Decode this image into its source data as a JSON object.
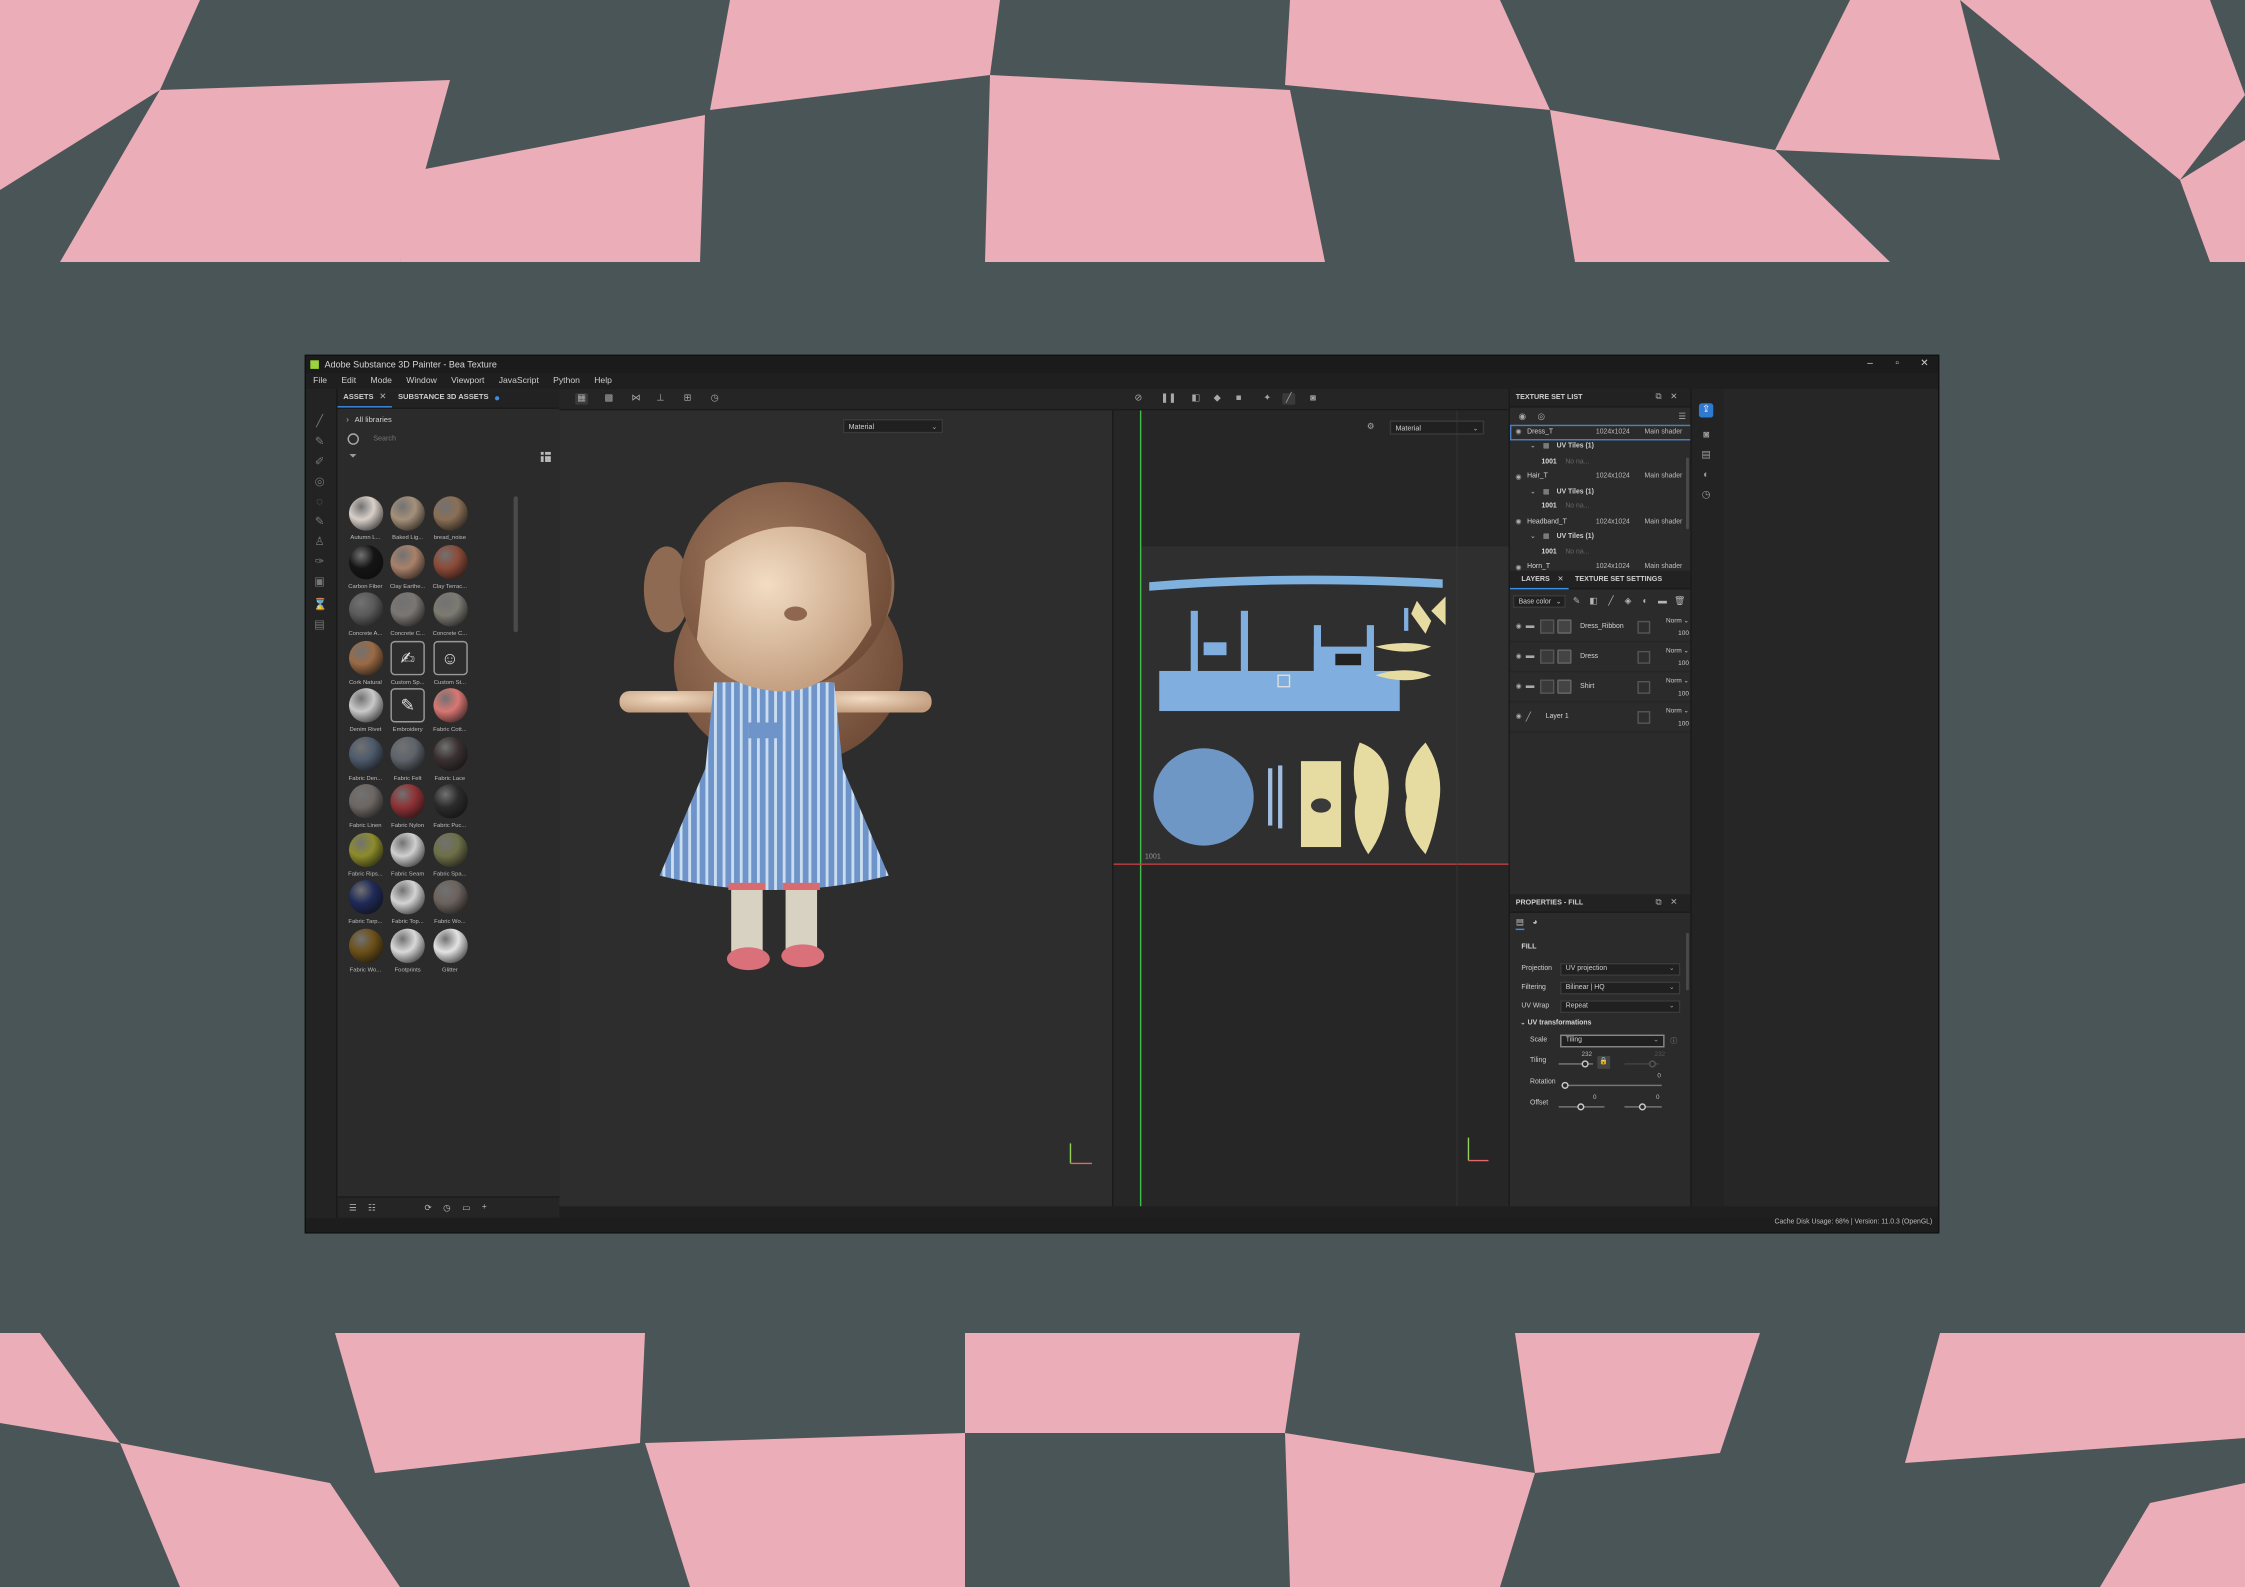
{
  "window": {
    "title": "Adobe Substance 3D Painter - Bea Texture",
    "controls": [
      "–",
      "▫",
      "✕"
    ]
  },
  "menu": [
    "File",
    "Edit",
    "Mode",
    "Window",
    "Viewport",
    "JavaScript",
    "Python",
    "Help"
  ],
  "assets": {
    "tab_assets": "ASSETS",
    "tab_s3d": "SUBSTANCE 3D ASSETS",
    "library": "All libraries",
    "search_placeholder": "Search",
    "items": [
      {
        "label": "Autumn L...",
        "color": "#d9cfc8",
        "accent": "#b5532b"
      },
      {
        "label": "Baked Lig...",
        "color": "#a59079"
      },
      {
        "label": "bread_noise",
        "color": "#8a6f55"
      },
      {
        "label": "Carbon Fiber",
        "color": "#151515"
      },
      {
        "label": "Clay Earthe...",
        "color": "#a9816a"
      },
      {
        "label": "Clay Terrac...",
        "color": "#8c4a37"
      },
      {
        "label": "Concrete A...",
        "color": "#5a5a5a"
      },
      {
        "label": "Concrete C...",
        "color": "#7a7673"
      },
      {
        "label": "Concrete C...",
        "color": "#7d7a72"
      },
      {
        "label": "Cork Natural",
        "color": "#9b6a44"
      },
      {
        "label": "Custom Sp...",
        "color": "#3a3a3a",
        "icon": "brush"
      },
      {
        "label": "Custom St...",
        "color": "#3a3a3a",
        "icon": "smiley"
      },
      {
        "label": "Denim Rivet",
        "color": "#c9c9c9",
        "accent": "#6b4b2e"
      },
      {
        "label": "Embroidery",
        "color": "#3a3a3a",
        "icon": "embroidery"
      },
      {
        "label": "Fabric Cott...",
        "color": "#d97773"
      },
      {
        "label": "Fabric Den...",
        "color": "#4d5a6b"
      },
      {
        "label": "Fabric Felt",
        "color": "#5e646b"
      },
      {
        "label": "Fabric Lace",
        "color": "#3a3031"
      },
      {
        "label": "Fabric Linen",
        "color": "#6c6663"
      },
      {
        "label": "Fabric Nylon",
        "color": "#8f3135"
      },
      {
        "label": "Fabric Puc...",
        "color": "#2b2b2b"
      },
      {
        "label": "Fabric Rips...",
        "color": "#8c8c2a"
      },
      {
        "label": "Fabric Seam",
        "color": "#cfcfcf"
      },
      {
        "label": "Fabric Spa...",
        "color": "#6e7048"
      },
      {
        "label": "Fabric Tarp...",
        "color": "#1f2a58"
      },
      {
        "label": "Fabric Top...",
        "color": "#d3d3d3"
      },
      {
        "label": "Fabric Wo...",
        "color": "#6c625d"
      },
      {
        "label": "Fabric Wo...",
        "color": "#6c5018"
      },
      {
        "label": "Footprints",
        "color": "#d9d9d9"
      },
      {
        "label": "Glitter",
        "color": "#e3e3e3"
      }
    ]
  },
  "viewport": {
    "channel_3d": "Material",
    "channel_2d": "Material",
    "uv_tile": "1001"
  },
  "texture_sets": {
    "title": "TEXTURE SET LIST",
    "sets": [
      {
        "name": "Dress_T",
        "res": "1024x1024",
        "shader": "Main shader",
        "uv": "UV Tiles (1)",
        "tile": "1001",
        "tile_note": "No na..."
      },
      {
        "name": "Hair_T",
        "res": "1024x1024",
        "shader": "Main shader",
        "uv": "UV Tiles (1)",
        "tile": "1001",
        "tile_note": "No na..."
      },
      {
        "name": "Headband_T",
        "res": "1024x1024",
        "shader": "Main shader",
        "uv": "UV Tiles (1)",
        "tile": "1001",
        "tile_note": "No na..."
      },
      {
        "name": "Horn_T",
        "res": "1024x1024",
        "shader": "Main shader"
      }
    ]
  },
  "layers": {
    "tab_layers": "LAYERS",
    "tab_settings": "TEXTURE SET SETTINGS",
    "channel": "Base color",
    "items": [
      {
        "name": "Dress_Ribbon",
        "blend": "Norm",
        "opacity": "100"
      },
      {
        "name": "Dress",
        "blend": "Norm",
        "opacity": "100"
      },
      {
        "name": "Shirt",
        "blend": "Norm",
        "opacity": "100"
      },
      {
        "name": "Layer 1",
        "blend": "Norm",
        "opacity": "100"
      }
    ]
  },
  "properties": {
    "title": "PROPERTIES - FILL",
    "section": "FILL",
    "projection_label": "Projection",
    "projection": "UV projection",
    "filtering_label": "Filtering",
    "filtering": "Bilinear | HQ",
    "uvwrap_label": "UV Wrap",
    "uvwrap": "Repeat",
    "uvt_label": "UV transformations",
    "scale_label": "Scale",
    "scale": "Tiling",
    "tiling_label": "Tiling",
    "tiling_value": "232",
    "tiling_value2": "232",
    "rotation_label": "Rotation",
    "rotation_value": "0",
    "offset_label": "Offset",
    "offset_x": "0",
    "offset_y": "0"
  },
  "status": {
    "text": "Cache Disk Usage:    68% | Version: 11.0.3 (OpenGL)"
  },
  "colors": {
    "deco_pink": "#ebadb7",
    "deco_dark": "#4a5557",
    "accent_blue": "#3a8ee6"
  }
}
